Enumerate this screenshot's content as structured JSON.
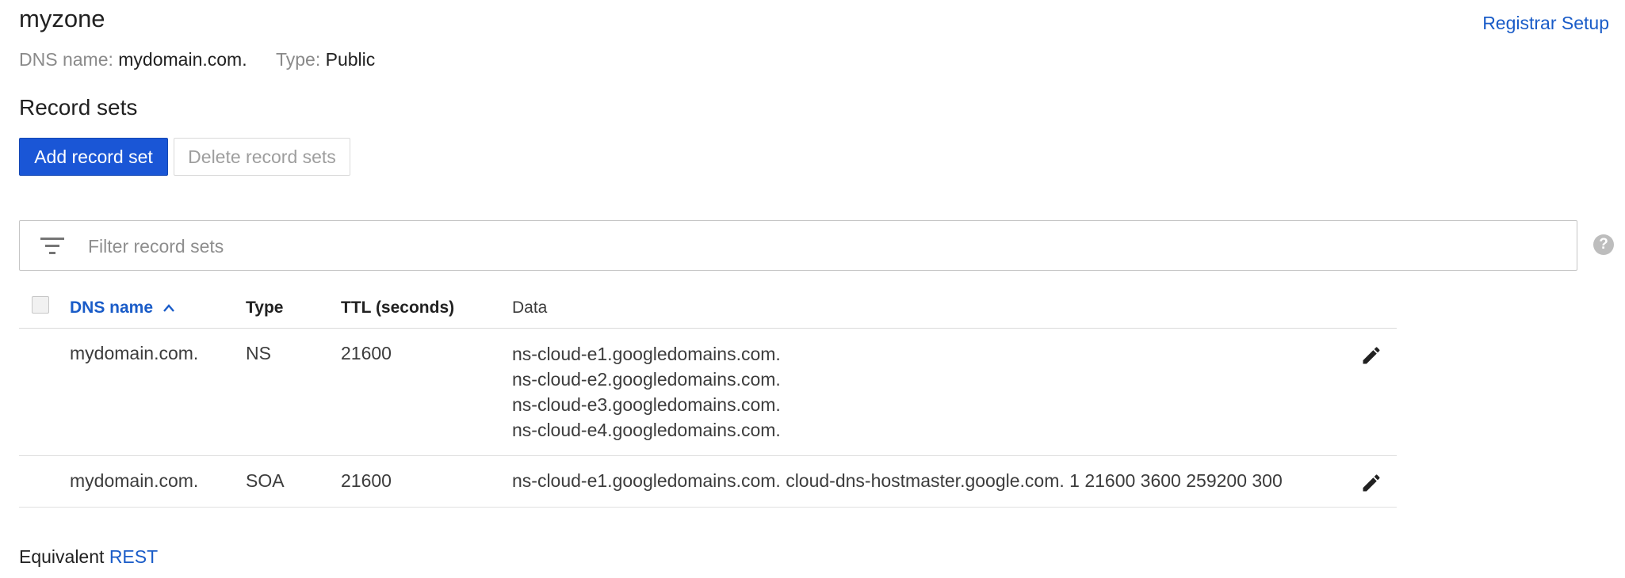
{
  "zone": {
    "title": "myzone",
    "dns_name_label": "DNS name:",
    "dns_name_value": "mydomain.com.",
    "type_label": "Type:",
    "type_value": "Public"
  },
  "header": {
    "registrar_link": "Registrar Setup"
  },
  "record_sets": {
    "title": "Record sets",
    "add_button": "Add record set",
    "delete_button": "Delete record sets"
  },
  "filter": {
    "placeholder": "Filter record sets",
    "icon": "filter-list-icon",
    "help_icon": "help-circle-icon"
  },
  "table": {
    "columns": {
      "dns_name": "DNS name",
      "type": "Type",
      "ttl": "TTL (seconds)",
      "data": "Data"
    },
    "sort": {
      "column": "DNS name",
      "direction": "ascending"
    },
    "rows": [
      {
        "dns_name": "mydomain.com.",
        "type": "NS",
        "ttl": "21600",
        "data": [
          "ns-cloud-e1.googledomains.com.",
          "ns-cloud-e2.googledomains.com.",
          "ns-cloud-e3.googledomains.com.",
          "ns-cloud-e4.googledomains.com."
        ]
      },
      {
        "dns_name": "mydomain.com.",
        "type": "SOA",
        "ttl": "21600",
        "data": [
          "ns-cloud-e1.googledomains.com. cloud-dns-hostmaster.google.com. 1 21600 3600 259200 300"
        ]
      }
    ]
  },
  "footer": {
    "prefix": "Equivalent",
    "link": "REST"
  },
  "colors": {
    "primary_blue": "#1a56d6",
    "link_blue": "#1a5cc8",
    "muted_text": "#8a8a8a"
  }
}
